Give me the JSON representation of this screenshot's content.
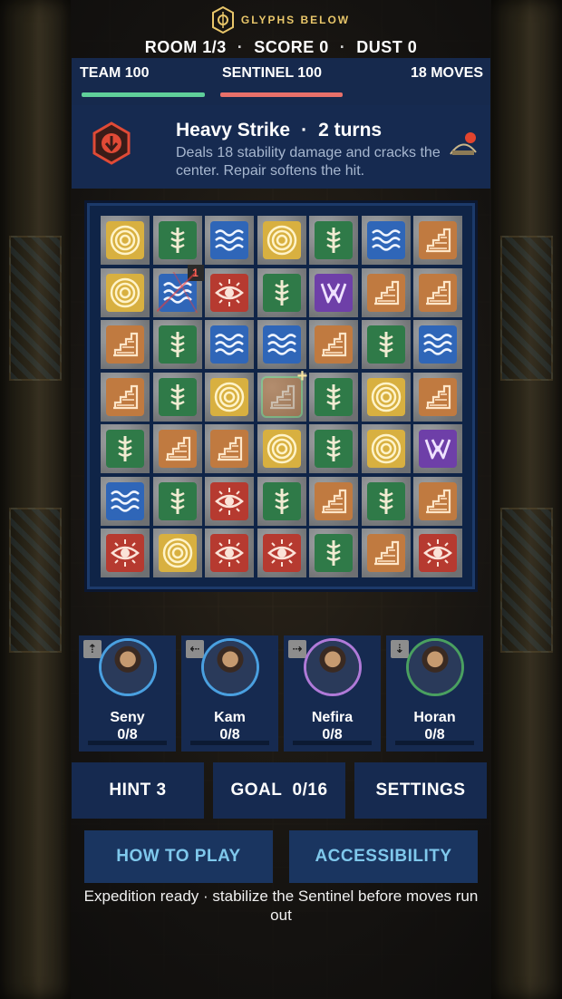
{
  "app": {
    "logo_text": "GLYPHS BELOW"
  },
  "stats": {
    "room": "ROOM 1/3",
    "score": "SCORE 0",
    "dust": "DUST 0",
    "separator": "·"
  },
  "bars": {
    "team_label": "TEAM 100",
    "sentinel_label": "SENTINEL 100",
    "moves_label": "18 MOVES",
    "team_color": "#5fcf9a",
    "sentinel_color": "#e8706a",
    "team_health": 1.0,
    "sentinel_health": 1.0
  },
  "enemy": {
    "attack_name": "Heavy Strike",
    "dot": "·",
    "turns": "2 turns",
    "description": "Deals 18 stability damage and cracks the center. Repair softens the hit.",
    "icon": "down-arrow-hex-icon"
  },
  "board": {
    "rows": [
      [
        "sun",
        "vine",
        "wave",
        "sun",
        "vine",
        "wave",
        "stair"
      ],
      [
        "sun",
        "wave-cracked",
        "eye",
        "vine",
        "w",
        "stair",
        "stair"
      ],
      [
        "stair",
        "vine",
        "wave",
        "wave",
        "stair",
        "vine",
        "wave"
      ],
      [
        "stair",
        "vine",
        "sun",
        "stair-repair",
        "vine",
        "sun",
        "stair"
      ],
      [
        "vine",
        "stair",
        "stair",
        "sun",
        "vine",
        "sun",
        "w"
      ],
      [
        "wave",
        "vine",
        "eye",
        "vine",
        "stair",
        "vine",
        "stair"
      ],
      [
        "eye",
        "sun",
        "eye",
        "eye",
        "vine",
        "stair",
        "eye"
      ]
    ],
    "crack_badge": "1",
    "repair_badge": "+"
  },
  "heroes": [
    {
      "name": "Seny",
      "charge": "0/8",
      "arrow": "⇡",
      "ring": "#4aa0e0"
    },
    {
      "name": "Kam",
      "charge": "0/8",
      "arrow": "⇠",
      "ring": "#4aa0e0"
    },
    {
      "name": "Nefira",
      "charge": "0/8",
      "arrow": "⇢",
      "ring": "#b07ad8"
    },
    {
      "name": "Horan",
      "charge": "0/8",
      "arrow": "⇣",
      "ring": "#4aa060"
    }
  ],
  "buttons": {
    "hint": "HINT 3",
    "goal": "GOAL  0/16",
    "settings": "SETTINGS",
    "how_to_play": "HOW TO PLAY",
    "accessibility": "ACCESSIBILITY"
  },
  "status": "Expedition ready · stabilize the Sentinel before moves run out"
}
